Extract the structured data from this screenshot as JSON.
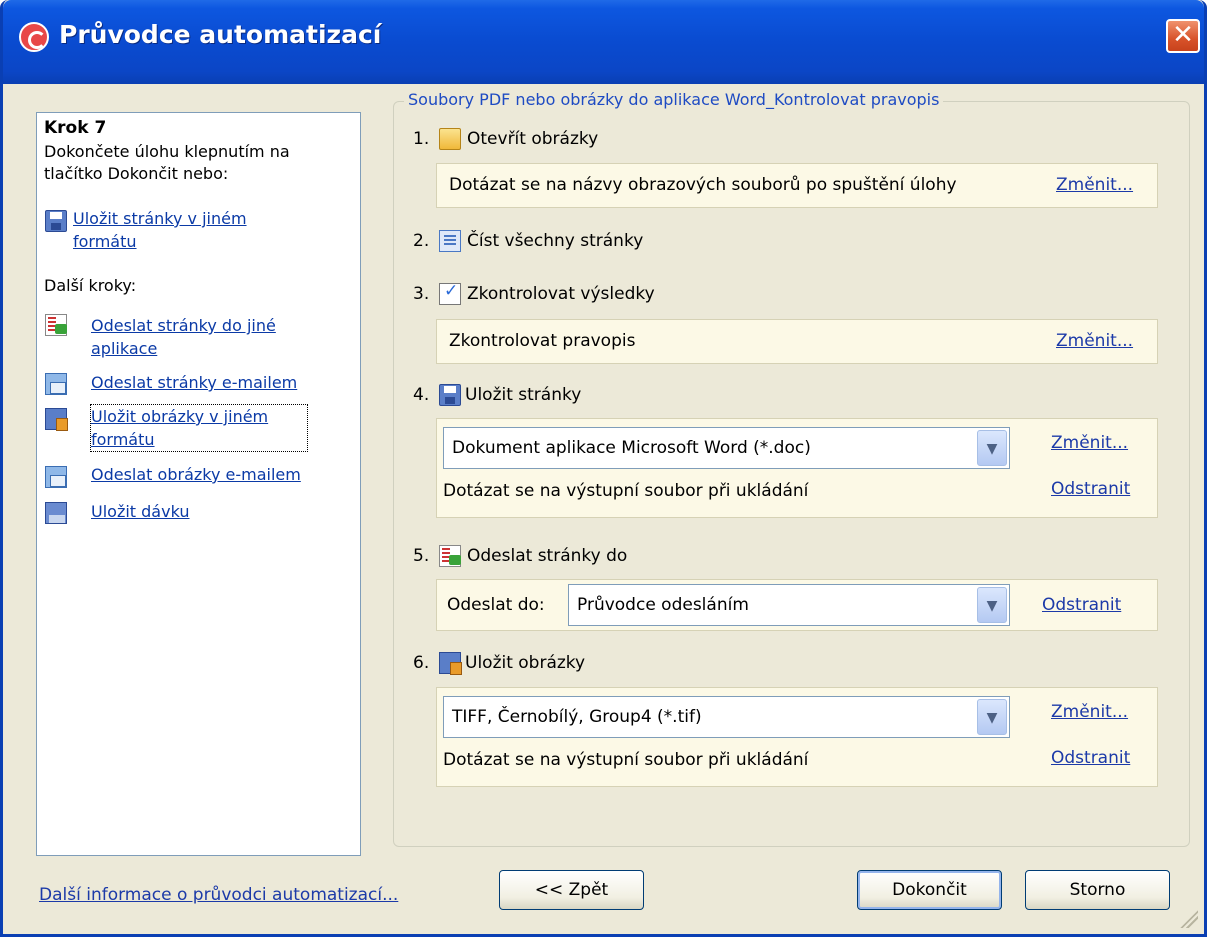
{
  "window": {
    "title": "Průvodce automatizací",
    "close_glyph": "✕"
  },
  "left": {
    "step_title": "Krok 7",
    "step_desc": "Dokončete úlohu klepnutím na tlačítko Dokončit nebo:",
    "save_pages_link": "Uložit stránky v jiném formátu",
    "next_steps_label": "Další kroky:",
    "links": {
      "send_pages_app": "Odeslat stránky do jiné aplikace",
      "send_pages_mail": "Odeslat stránky e-mailem",
      "save_images_format": "Uložit obrázky v jiném formátu",
      "send_images_mail": "Odeslat obrázky e-mailem",
      "save_batch": "Uložit dávku"
    }
  },
  "group": {
    "legend": "Soubory PDF nebo obrázky do aplikace Word_Kontrolovat pravopis"
  },
  "steps": {
    "s1": {
      "num": "1.",
      "label": "Otevřít obrázky",
      "desc": "Dotázat se na názvy obrazových souborů po spuštění úlohy",
      "link": "Změnit..."
    },
    "s2": {
      "num": "2.",
      "label": "Číst všechny stránky"
    },
    "s3": {
      "num": "3.",
      "label": "Zkontrolovat výsledky",
      "desc": "Zkontrolovat pravopis",
      "link": "Změnit..."
    },
    "s4": {
      "num": "4.",
      "label": "Uložit stránky",
      "combo": "Dokument aplikace Microsoft Word (*.doc)",
      "link_change": "Změnit...",
      "desc": "Dotázat se na výstupní soubor při ukládání",
      "link_remove": "Odstranit"
    },
    "s5": {
      "num": "5.",
      "label": "Odeslat stránky do",
      "send_label": "Odeslat do:",
      "combo": "Průvodce odesláním",
      "link_remove": "Odstranit"
    },
    "s6": {
      "num": "6.",
      "label": "Uložit obrázky",
      "combo": "TIFF, Černobílý, Group4 (*.tif)",
      "link_change": "Změnit...",
      "desc": "Dotázat se na výstupní soubor při ukládání",
      "link_remove": "Odstranit"
    }
  },
  "footer": {
    "info_link": "Další informace o průvodci automatizací...",
    "back": "<< Zpět",
    "finish": "Dokončit",
    "cancel": "Storno"
  }
}
